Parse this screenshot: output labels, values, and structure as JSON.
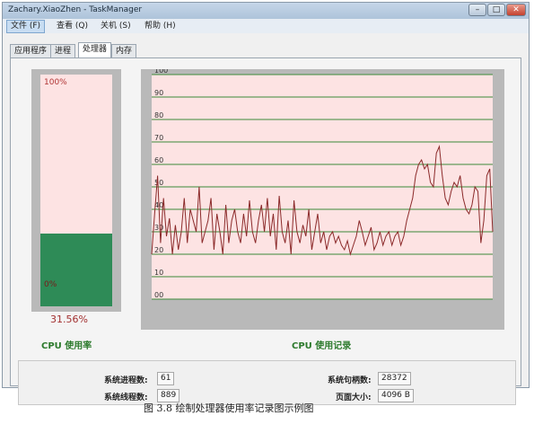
{
  "window": {
    "title": "Zachary.XiaoZhen - TaskManager",
    "controls": {
      "minimize": "–",
      "maximize": "□",
      "close": "✕"
    }
  },
  "menu": [
    {
      "label": "文件 (F)",
      "active": true
    },
    {
      "label": "查看 (Q)",
      "active": false
    },
    {
      "label": "关机 (S)",
      "active": false
    },
    {
      "label": "帮助 (H)",
      "active": false
    }
  ],
  "tabs": [
    {
      "label": "应用程序",
      "selected": false
    },
    {
      "label": "进程",
      "selected": false
    },
    {
      "label": "处理器",
      "selected": true
    },
    {
      "label": "内存",
      "selected": false
    }
  ],
  "cpu_meter": {
    "top_label": "100%",
    "bottom_label": "0%",
    "value_text": "31.56%",
    "level_percent": 31.56,
    "caption": "CPU 使用率",
    "colors": {
      "fill": "#2e8b57",
      "background": "#fde3e3"
    }
  },
  "cpu_history": {
    "caption": "CPU 使用记录",
    "colors": {
      "line": "#8b2a2a",
      "grid": "#3a8a3a",
      "background": "#fde3e3"
    }
  },
  "chart_data": {
    "type": "line",
    "ylim": [
      0,
      100
    ],
    "yticks": [
      "00",
      "10",
      "20",
      "30",
      "40",
      "50",
      "60",
      "70",
      "80",
      "90",
      "100"
    ],
    "grid": true,
    "series": [
      {
        "values": [
          20,
          38,
          55,
          25,
          45,
          28,
          36,
          20,
          33,
          22,
          30,
          45,
          25,
          40,
          35,
          30,
          50,
          25,
          30,
          35,
          45,
          22,
          38,
          30,
          20,
          42,
          25,
          35,
          40,
          30,
          25,
          38,
          28,
          44,
          30,
          25,
          35,
          42,
          30,
          45,
          28,
          38,
          22,
          46,
          30,
          25,
          35,
          20,
          44,
          30,
          25,
          33,
          28,
          40,
          22,
          30,
          38,
          25,
          30,
          22,
          28,
          30,
          25,
          28,
          24,
          22,
          26,
          20,
          24,
          28,
          35,
          30,
          24,
          28,
          32,
          22,
          25,
          30,
          24,
          28,
          30,
          24,
          28,
          30,
          24,
          28,
          35,
          40,
          45,
          55,
          60,
          62,
          58,
          60,
          52,
          50,
          65,
          68,
          55,
          45,
          42,
          48,
          52,
          50,
          55,
          45,
          40,
          38,
          42,
          50,
          48,
          25,
          35,
          55,
          58,
          30
        ]
      }
    ]
  },
  "stats": {
    "process_count": {
      "label": "系统进程数:",
      "value": "61"
    },
    "thread_count": {
      "label": "系统线程数:",
      "value": "889"
    },
    "handle_count": {
      "label": "系统句柄数:",
      "value": "28372"
    },
    "page_size": {
      "label": "页面大小:",
      "value": "4096 B"
    }
  },
  "figure_caption": "图 3.8 绘制处理器使用率记录图示例图"
}
